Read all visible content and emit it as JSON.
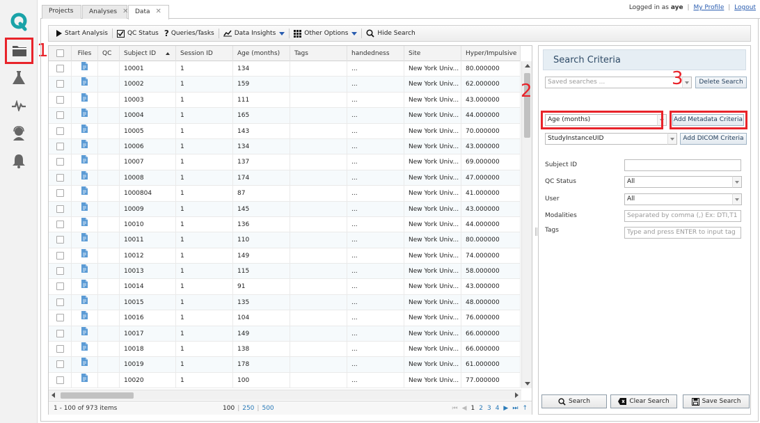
{
  "annotations": [
    "1",
    "2",
    "3"
  ],
  "sidebar": {
    "items": [
      {
        "name": "logo",
        "icon": "q-logo-icon"
      },
      {
        "name": "data",
        "icon": "folder-icon"
      },
      {
        "name": "analyses",
        "icon": "flask-icon"
      },
      {
        "name": "pipelines",
        "icon": "pulse-icon"
      },
      {
        "name": "support",
        "icon": "headset-icon"
      },
      {
        "name": "notifications",
        "icon": "bell-icon"
      }
    ],
    "accent": "#1aa3a8"
  },
  "tabs": [
    {
      "label": "Projects",
      "closable": false
    },
    {
      "label": "Analyses",
      "closable": true
    },
    {
      "label": "Data",
      "closable": true,
      "active": true
    }
  ],
  "header": {
    "logged_in_prefix": "Logged in as",
    "username": "aye",
    "my_profile": "My Profile",
    "logout": "Logout"
  },
  "toolbar": {
    "start_analysis": "Start Analysis",
    "qc_status": "QC Status",
    "queries_tasks": "Queries/Tasks",
    "data_insights": "Data Insights",
    "other_options": "Other Options",
    "hide_search": "Hide Search"
  },
  "grid": {
    "columns": [
      "Files",
      "QC",
      "Subject ID",
      "Session ID",
      "Age (months)",
      "Tags",
      "handedness",
      "Site",
      "Hyper/Impulsive"
    ],
    "rows": [
      {
        "subject": "10001",
        "session": "1",
        "age": "134",
        "hand": "...",
        "site": "New York Univ...",
        "hyper": "80.000000"
      },
      {
        "subject": "10002",
        "session": "1",
        "age": "159",
        "hand": "...",
        "site": "New York Univ...",
        "hyper": "62.000000"
      },
      {
        "subject": "10003",
        "session": "1",
        "age": "111",
        "hand": "...",
        "site": "New York Univ...",
        "hyper": "43.000000"
      },
      {
        "subject": "10004",
        "session": "1",
        "age": "165",
        "hand": "...",
        "site": "New York Univ...",
        "hyper": "44.000000"
      },
      {
        "subject": "10005",
        "session": "1",
        "age": "143",
        "hand": "...",
        "site": "New York Univ...",
        "hyper": "70.000000"
      },
      {
        "subject": "10006",
        "session": "1",
        "age": "134",
        "hand": "...",
        "site": "New York Univ...",
        "hyper": "43.000000"
      },
      {
        "subject": "10007",
        "session": "1",
        "age": "137",
        "hand": "...",
        "site": "New York Univ...",
        "hyper": "69.000000"
      },
      {
        "subject": "10008",
        "session": "1",
        "age": "174",
        "hand": "...",
        "site": "New York Univ...",
        "hyper": "47.000000"
      },
      {
        "subject": "1000804",
        "session": "1",
        "age": "87",
        "hand": "...",
        "site": "New York Univ...",
        "hyper": "41.000000"
      },
      {
        "subject": "10009",
        "session": "1",
        "age": "145",
        "hand": "...",
        "site": "New York Univ...",
        "hyper": "43.000000"
      },
      {
        "subject": "10010",
        "session": "1",
        "age": "136",
        "hand": "...",
        "site": "New York Univ...",
        "hyper": "44.000000"
      },
      {
        "subject": "10011",
        "session": "1",
        "age": "110",
        "hand": "...",
        "site": "New York Univ...",
        "hyper": "80.000000"
      },
      {
        "subject": "10012",
        "session": "1",
        "age": "149",
        "hand": "...",
        "site": "New York Univ...",
        "hyper": "74.000000"
      },
      {
        "subject": "10013",
        "session": "1",
        "age": "115",
        "hand": "...",
        "site": "New York Univ...",
        "hyper": "58.000000"
      },
      {
        "subject": "10014",
        "session": "1",
        "age": "91",
        "hand": "...",
        "site": "New York Univ...",
        "hyper": "43.000000"
      },
      {
        "subject": "10015",
        "session": "1",
        "age": "135",
        "hand": "...",
        "site": "New York Univ...",
        "hyper": "48.000000"
      },
      {
        "subject": "10016",
        "session": "1",
        "age": "104",
        "hand": "...",
        "site": "New York Univ...",
        "hyper": "76.000000"
      },
      {
        "subject": "10017",
        "session": "1",
        "age": "149",
        "hand": "...",
        "site": "New York Univ...",
        "hyper": "66.000000"
      },
      {
        "subject": "10018",
        "session": "1",
        "age": "138",
        "hand": "...",
        "site": "New York Univ...",
        "hyper": "66.000000"
      },
      {
        "subject": "10019",
        "session": "1",
        "age": "178",
        "hand": "...",
        "site": "New York Univ...",
        "hyper": "61.000000"
      },
      {
        "subject": "10020",
        "session": "1",
        "age": "100",
        "hand": "...",
        "site": "New York Univ...",
        "hyper": "77.000000"
      }
    ]
  },
  "pager": {
    "count": "1 - 100 of 973 items",
    "size_current": "100",
    "size_250": "250",
    "size_500": "500",
    "pages": [
      "1",
      "2",
      "3",
      "4"
    ]
  },
  "search": {
    "title": "Search Criteria",
    "saved_placeholder": "Saved searches ...",
    "delete_search": "Delete Search",
    "metadata_field": "Age (months)",
    "add_metadata": "Add Metadata Criteria",
    "dicom_field": "StudyInstanceUID",
    "add_dicom": "Add DICOM Criteria",
    "subject_id_label": "Subject ID",
    "qc_status_label": "QC Status",
    "qc_status_value": "All",
    "user_label": "User",
    "user_value": "All",
    "modalities_label": "Modalities",
    "modalities_placeholder": "Separated by comma (,) Ex: DTI,T1",
    "tags_label": "Tags",
    "tags_placeholder": "Type and press ENTER to input tag",
    "search_btn": "Search",
    "clear_btn": "Clear Search",
    "save_btn": "Save Search"
  }
}
